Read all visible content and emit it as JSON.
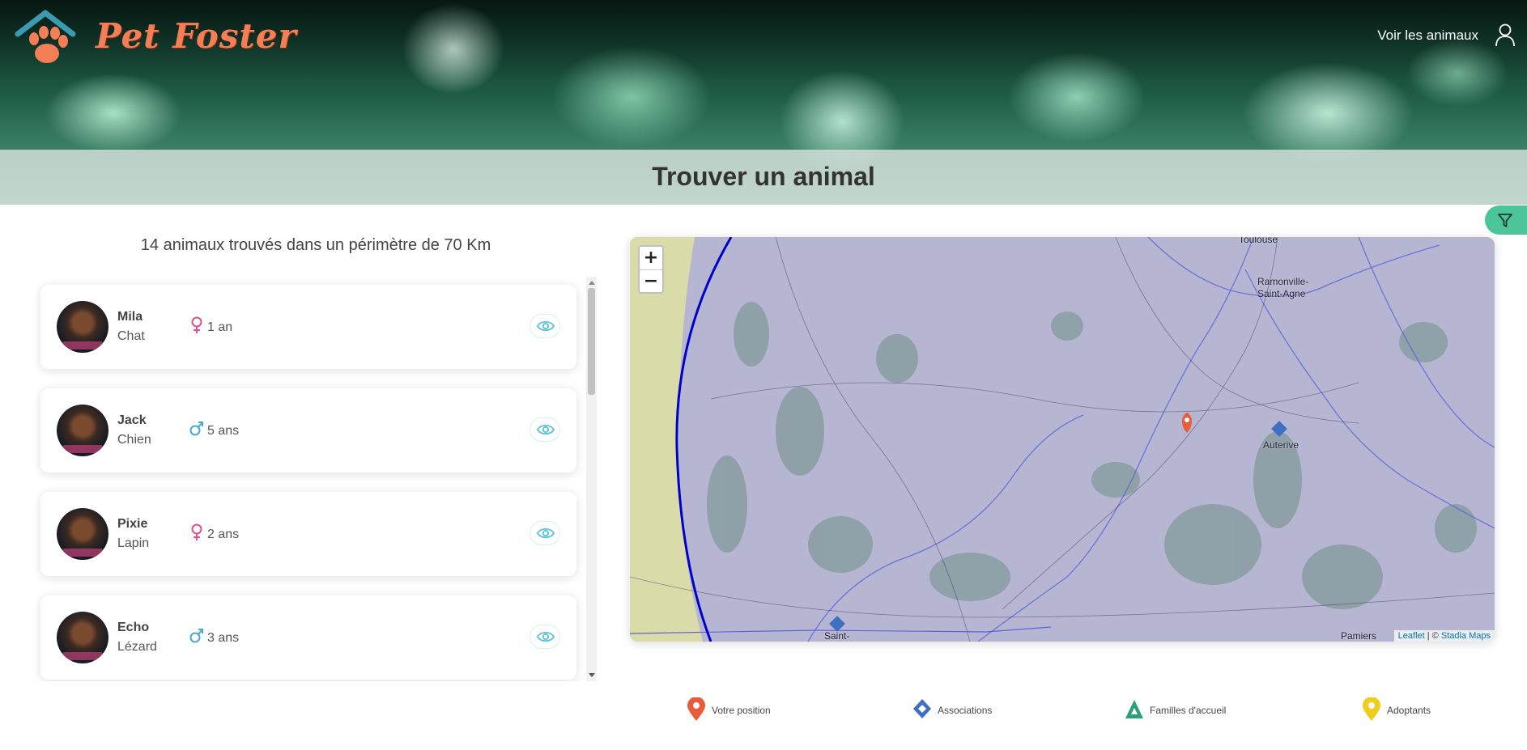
{
  "header": {
    "brand": "Pet Foster",
    "nav_link": "Voir les animaux",
    "page_title": "Trouver un animal"
  },
  "results": {
    "summary": "14 animaux trouvés dans un périmètre de 70 Km"
  },
  "pets": [
    {
      "name": "Mila",
      "species": "Chat",
      "sex": "female",
      "age": "1 an"
    },
    {
      "name": "Jack",
      "species": "Chien",
      "sex": "male",
      "age": "5 ans"
    },
    {
      "name": "Pixie",
      "species": "Lapin",
      "sex": "female",
      "age": "2 ans"
    },
    {
      "name": "Echo",
      "species": "Lézard",
      "sex": "male",
      "age": "3 ans"
    }
  ],
  "map": {
    "zoom_in": "+",
    "zoom_out": "−",
    "attribution_leaflet": "Leaflet",
    "attribution_sep": " | © ",
    "attribution_stadia": "Stadia Maps",
    "places": [
      "Toulouse",
      "Ramonville-\nSaint-Agne",
      "Auterive",
      "Saint-",
      "Pamiers"
    ]
  },
  "legend": [
    {
      "label": "Votre position",
      "icon": "red-pin-icon",
      "color": "#e85c3a"
    },
    {
      "label": "Associations",
      "icon": "blue-diamond-icon",
      "color": "#3f6fc1"
    },
    {
      "label": "Familles d'accueil",
      "icon": "green-triangle-icon",
      "color": "#2aa07a"
    },
    {
      "label": "Adoptants",
      "icon": "yellow-pin-icon",
      "color": "#f2cc1c"
    }
  ],
  "colors": {
    "accent": "#4cc59a",
    "brand": "#f47e56",
    "female": "#e0508c",
    "male": "#4aa7d8",
    "eye": "#5bc0de",
    "radius_circle": "#0000cc"
  }
}
